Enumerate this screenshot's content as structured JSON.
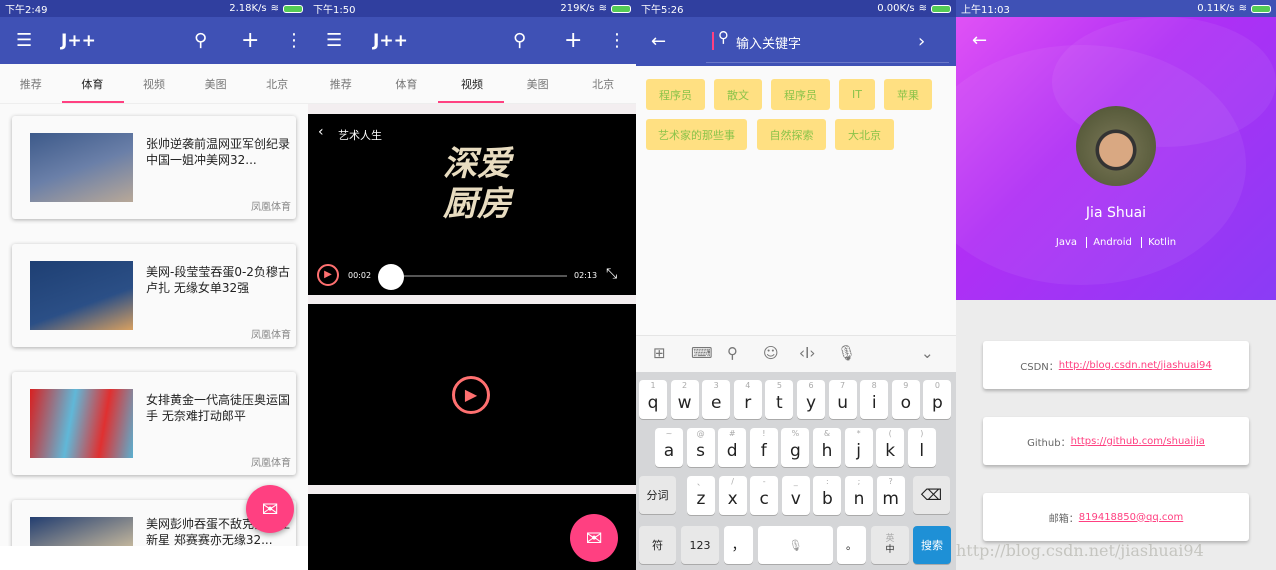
{
  "panels": [
    {
      "status": {
        "time": "下午2:49",
        "speed": "2.18K/s"
      },
      "app_title": "J++",
      "tabs": [
        "推荐",
        "体育",
        "视频",
        "美图",
        "北京"
      ],
      "active_tab": 1,
      "news": [
        {
          "title": "张帅逆袭前温网亚军创纪录 中国一姐冲美网32...",
          "source": "凤凰体育"
        },
        {
          "title": "美网-段莹莹吞蛋0-2负穆古卢扎 无缘女单32强",
          "source": "凤凰体育"
        },
        {
          "title": "女排黄金一代高徒压奥运国手 无奈难打动郎平",
          "source": "凤凰体育"
        },
        {
          "title": "美网彭帅吞蛋不敌克罗地亚新星 郑赛赛亦无缘32...",
          "source": ""
        }
      ]
    },
    {
      "status": {
        "time": "下午1:50",
        "speed": "219K/s"
      },
      "app_title": "J++",
      "tabs": [
        "推荐",
        "体育",
        "视频",
        "美图",
        "北京"
      ],
      "active_tab": 2,
      "video": {
        "title": "艺术人生",
        "poster_text": "深爱厨房",
        "current": "00:02",
        "duration": "02:13",
        "progress": 0.015
      }
    },
    {
      "status": {
        "time": "下午5:26",
        "speed": "0.00K/s"
      },
      "search_placeholder": "输入关键字",
      "tags": [
        "程序员",
        "散文",
        "程序员",
        "IT",
        "苹果",
        "艺术家的那些事",
        "自然探索",
        "大北京"
      ],
      "keyboard": {
        "row1": [
          [
            "1",
            "q"
          ],
          [
            "2",
            "w"
          ],
          [
            "3",
            "e"
          ],
          [
            "4",
            "r"
          ],
          [
            "5",
            "t"
          ],
          [
            "6",
            "y"
          ],
          [
            "7",
            "u"
          ],
          [
            "8",
            "i"
          ],
          [
            "9",
            "o"
          ],
          [
            "0",
            "p"
          ]
        ],
        "row2": [
          [
            "~",
            "a"
          ],
          [
            "@",
            "s"
          ],
          [
            "#",
            "d"
          ],
          [
            "!",
            "f"
          ],
          [
            "%",
            "g"
          ],
          [
            "&",
            "h"
          ],
          [
            "*",
            "j"
          ],
          [
            "(",
            "k"
          ],
          [
            ")",
            "l"
          ]
        ],
        "row3": [
          [
            "、",
            "z"
          ],
          [
            "/",
            "x"
          ],
          [
            "-",
            "c"
          ],
          [
            "_",
            "v"
          ],
          [
            ":",
            "b"
          ],
          [
            ";",
            "n"
          ],
          [
            "?",
            "m"
          ]
        ],
        "segment": "分词",
        "symbols": "符",
        "numbers": "123",
        "comma": "，",
        "period": "。",
        "lang_top": "英",
        "lang_bottom": "中",
        "search": "搜索"
      }
    },
    {
      "status": {
        "time": "上午11:03",
        "speed": "0.11K/s"
      },
      "name": "Jia Shuai",
      "skills": [
        "Java",
        "Android",
        "Kotlin"
      ],
      "links": [
        {
          "label": "CSDN：",
          "value": "http://blog.csdn.net/jiashuai94"
        },
        {
          "label": "Github：",
          "value": "https://github.com/shuaijia"
        },
        {
          "label": "邮箱：",
          "value": "819418850@qq.com"
        }
      ],
      "watermark": "http://blog.csdn.net/jiashuai94"
    }
  ],
  "colors": {
    "primary": "#3f51b5",
    "accent": "#ff4081",
    "tag_bg": "#ffe082",
    "tag_text": "#8bc34a"
  }
}
